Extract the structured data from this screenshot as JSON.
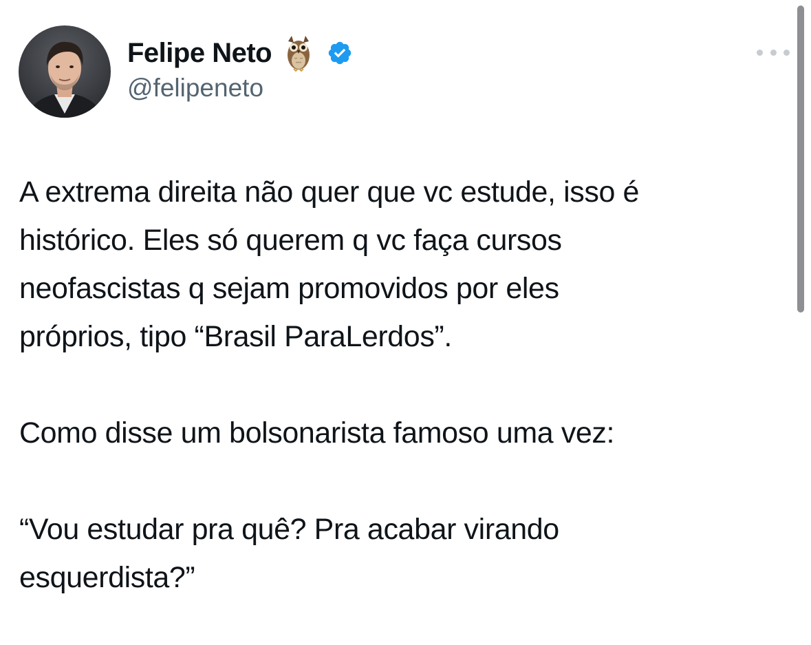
{
  "author": {
    "display_name": "Felipe Neto",
    "emoji_icon": "owl-emoji",
    "verified": true,
    "verified_color": "#1d9bf0",
    "handle": "@felipeneto"
  },
  "menu": {
    "icon": "more-horizontal-icon"
  },
  "tweet": {
    "paragraphs": [
      {
        "lines": [
          "A extrema direita não quer que vc estude, isso é",
          "histórico. Eles só querem q vc faça cursos",
          "neofascistas q sejam promovidos por eles",
          "próprios, tipo “Brasil ParaLerdos”."
        ]
      },
      {
        "lines": [
          "Como disse um bolsonarista famoso uma vez:"
        ]
      },
      {
        "lines": [
          "“Vou estudar pra quê? Pra acabar virando",
          "esquerdista?”"
        ]
      }
    ]
  }
}
